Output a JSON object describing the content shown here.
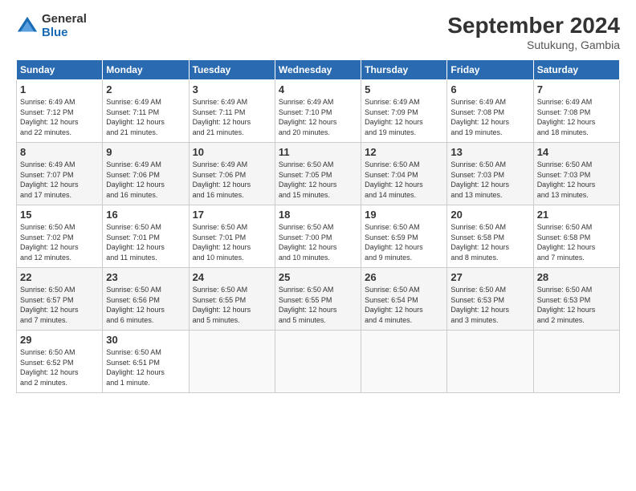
{
  "header": {
    "logo_general": "General",
    "logo_blue": "Blue",
    "month_title": "September 2024",
    "location": "Sutukung, Gambia"
  },
  "weekdays": [
    "Sunday",
    "Monday",
    "Tuesday",
    "Wednesday",
    "Thursday",
    "Friday",
    "Saturday"
  ],
  "weeks": [
    [
      {
        "day": "1",
        "info": "Sunrise: 6:49 AM\nSunset: 7:12 PM\nDaylight: 12 hours\nand 22 minutes."
      },
      {
        "day": "2",
        "info": "Sunrise: 6:49 AM\nSunset: 7:11 PM\nDaylight: 12 hours\nand 21 minutes."
      },
      {
        "day": "3",
        "info": "Sunrise: 6:49 AM\nSunset: 7:11 PM\nDaylight: 12 hours\nand 21 minutes."
      },
      {
        "day": "4",
        "info": "Sunrise: 6:49 AM\nSunset: 7:10 PM\nDaylight: 12 hours\nand 20 minutes."
      },
      {
        "day": "5",
        "info": "Sunrise: 6:49 AM\nSunset: 7:09 PM\nDaylight: 12 hours\nand 19 minutes."
      },
      {
        "day": "6",
        "info": "Sunrise: 6:49 AM\nSunset: 7:08 PM\nDaylight: 12 hours\nand 19 minutes."
      },
      {
        "day": "7",
        "info": "Sunrise: 6:49 AM\nSunset: 7:08 PM\nDaylight: 12 hours\nand 18 minutes."
      }
    ],
    [
      {
        "day": "8",
        "info": "Sunrise: 6:49 AM\nSunset: 7:07 PM\nDaylight: 12 hours\nand 17 minutes."
      },
      {
        "day": "9",
        "info": "Sunrise: 6:49 AM\nSunset: 7:06 PM\nDaylight: 12 hours\nand 16 minutes."
      },
      {
        "day": "10",
        "info": "Sunrise: 6:49 AM\nSunset: 7:06 PM\nDaylight: 12 hours\nand 16 minutes."
      },
      {
        "day": "11",
        "info": "Sunrise: 6:50 AM\nSunset: 7:05 PM\nDaylight: 12 hours\nand 15 minutes."
      },
      {
        "day": "12",
        "info": "Sunrise: 6:50 AM\nSunset: 7:04 PM\nDaylight: 12 hours\nand 14 minutes."
      },
      {
        "day": "13",
        "info": "Sunrise: 6:50 AM\nSunset: 7:03 PM\nDaylight: 12 hours\nand 13 minutes."
      },
      {
        "day": "14",
        "info": "Sunrise: 6:50 AM\nSunset: 7:03 PM\nDaylight: 12 hours\nand 13 minutes."
      }
    ],
    [
      {
        "day": "15",
        "info": "Sunrise: 6:50 AM\nSunset: 7:02 PM\nDaylight: 12 hours\nand 12 minutes."
      },
      {
        "day": "16",
        "info": "Sunrise: 6:50 AM\nSunset: 7:01 PM\nDaylight: 12 hours\nand 11 minutes."
      },
      {
        "day": "17",
        "info": "Sunrise: 6:50 AM\nSunset: 7:01 PM\nDaylight: 12 hours\nand 10 minutes."
      },
      {
        "day": "18",
        "info": "Sunrise: 6:50 AM\nSunset: 7:00 PM\nDaylight: 12 hours\nand 10 minutes."
      },
      {
        "day": "19",
        "info": "Sunrise: 6:50 AM\nSunset: 6:59 PM\nDaylight: 12 hours\nand 9 minutes."
      },
      {
        "day": "20",
        "info": "Sunrise: 6:50 AM\nSunset: 6:58 PM\nDaylight: 12 hours\nand 8 minutes."
      },
      {
        "day": "21",
        "info": "Sunrise: 6:50 AM\nSunset: 6:58 PM\nDaylight: 12 hours\nand 7 minutes."
      }
    ],
    [
      {
        "day": "22",
        "info": "Sunrise: 6:50 AM\nSunset: 6:57 PM\nDaylight: 12 hours\nand 7 minutes."
      },
      {
        "day": "23",
        "info": "Sunrise: 6:50 AM\nSunset: 6:56 PM\nDaylight: 12 hours\nand 6 minutes."
      },
      {
        "day": "24",
        "info": "Sunrise: 6:50 AM\nSunset: 6:55 PM\nDaylight: 12 hours\nand 5 minutes."
      },
      {
        "day": "25",
        "info": "Sunrise: 6:50 AM\nSunset: 6:55 PM\nDaylight: 12 hours\nand 5 minutes."
      },
      {
        "day": "26",
        "info": "Sunrise: 6:50 AM\nSunset: 6:54 PM\nDaylight: 12 hours\nand 4 minutes."
      },
      {
        "day": "27",
        "info": "Sunrise: 6:50 AM\nSunset: 6:53 PM\nDaylight: 12 hours\nand 3 minutes."
      },
      {
        "day": "28",
        "info": "Sunrise: 6:50 AM\nSunset: 6:53 PM\nDaylight: 12 hours\nand 2 minutes."
      }
    ],
    [
      {
        "day": "29",
        "info": "Sunrise: 6:50 AM\nSunset: 6:52 PM\nDaylight: 12 hours\nand 2 minutes."
      },
      {
        "day": "30",
        "info": "Sunrise: 6:50 AM\nSunset: 6:51 PM\nDaylight: 12 hours\nand 1 minute."
      },
      {
        "day": "",
        "info": ""
      },
      {
        "day": "",
        "info": ""
      },
      {
        "day": "",
        "info": ""
      },
      {
        "day": "",
        "info": ""
      },
      {
        "day": "",
        "info": ""
      }
    ]
  ]
}
